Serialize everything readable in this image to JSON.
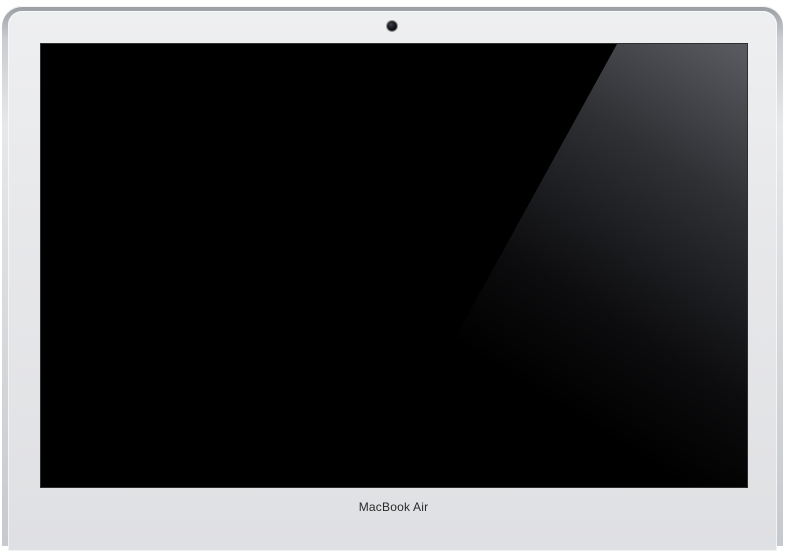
{
  "device": {
    "brand_label": "MacBook Air",
    "screen_state": "off"
  },
  "icons": {
    "camera": "camera-icon"
  },
  "colors": {
    "screen": "#000000",
    "bezel": "#e7e8ea",
    "frame": "#c9ccd0"
  }
}
